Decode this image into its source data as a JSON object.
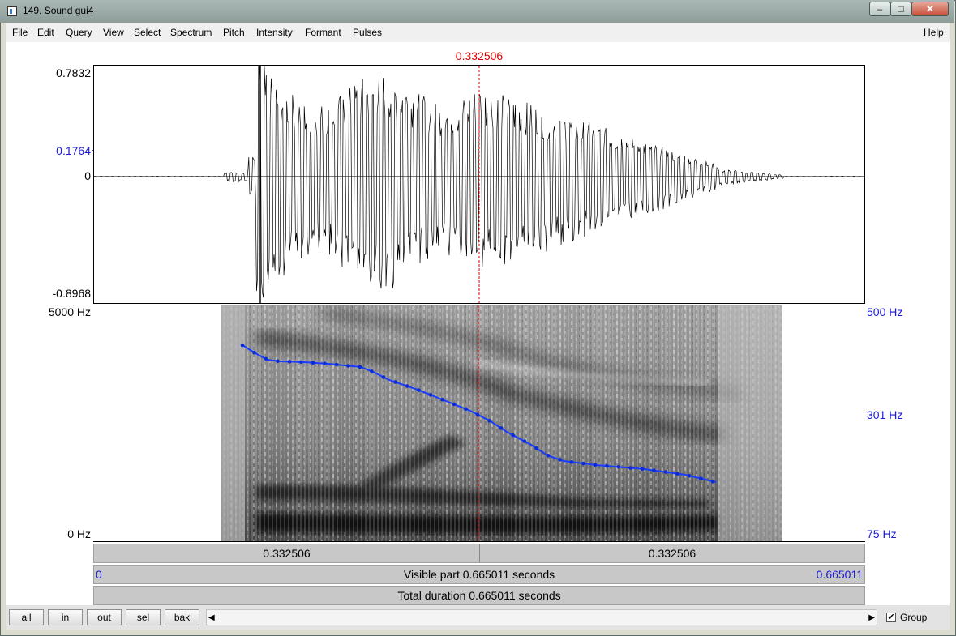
{
  "window": {
    "title": "149. Sound gui4",
    "minimize": "–",
    "maximize": "□",
    "close": "✕"
  },
  "menu": {
    "items": [
      "File",
      "Edit",
      "Query",
      "View",
      "Select",
      "Spectrum",
      "Pitch",
      "Intensity",
      "Formant",
      "Pulses"
    ],
    "help": "Help"
  },
  "cursor": {
    "time": "0.332506",
    "color": "#e00000"
  },
  "waveform": {
    "max": "0.7832",
    "cursor_value": "0.1764",
    "zero": "0",
    "min": "-0.8968"
  },
  "spectrogram": {
    "freq_top": "5000 Hz",
    "freq_bottom": "0 Hz",
    "pitch_top": "500 Hz",
    "pitch_mid": "301 Hz",
    "pitch_bottom": "75 Hz",
    "pitch_color": "#1a3cff"
  },
  "timebar": {
    "left_segment": "0.332506",
    "right_segment": "0.332506",
    "start": "0",
    "visible": "Visible part 0.665011 seconds",
    "end": "0.665011",
    "total": "Total duration 0.665011 seconds"
  },
  "buttons": {
    "all": "all",
    "in": "in",
    "out": "out",
    "sel": "sel",
    "bak": "bak"
  },
  "group": {
    "label": "Group",
    "checked": true,
    "mark": "✔"
  },
  "scroll": {
    "left_arrow": "◀",
    "right_arrow": "▶"
  }
}
